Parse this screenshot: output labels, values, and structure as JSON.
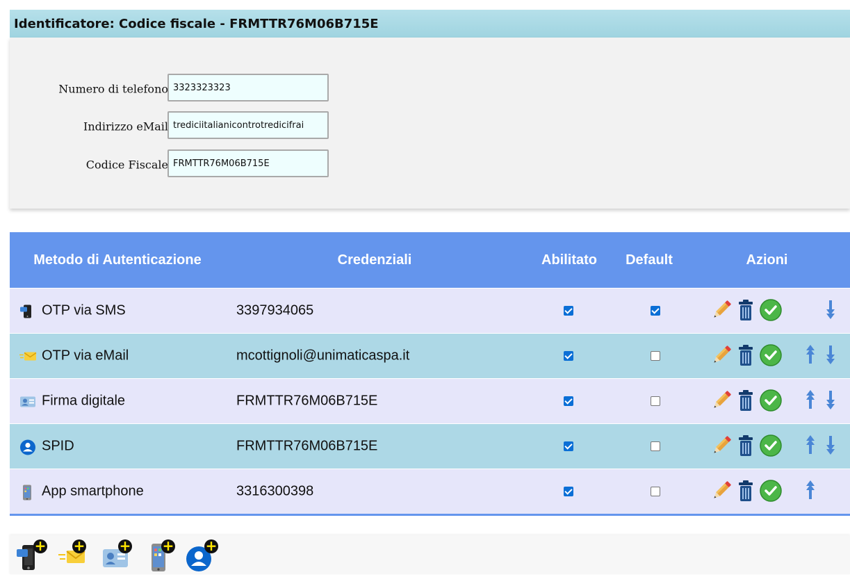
{
  "header": {
    "title": "Identificatore: Codice fiscale - FRMTTR76M06B715E"
  },
  "form": {
    "phone_label": "Numero di telefono",
    "phone_value": "3323323323",
    "email_label": "Indirizzo eMail",
    "email_value": "trediciitalianicontrotredicifrai",
    "cf_label": "Codice Fiscale",
    "cf_value": "FRMTTR76M06B715E"
  },
  "table": {
    "headers": {
      "method": "Metodo di Autenticazione",
      "credentials": "Credenziali",
      "enabled": "Abilitato",
      "default": "Default",
      "actions": "Azioni"
    },
    "rows": [
      {
        "method": "OTP via SMS",
        "icon": "sms-phone-icon",
        "credentials": "3397934065",
        "enabled": true,
        "default": true,
        "can_move_up": false,
        "can_move_down": true
      },
      {
        "method": "OTP via eMail",
        "icon": "email-envelope-icon",
        "credentials": "mcottignoli@unimaticaspa.it",
        "enabled": true,
        "default": false,
        "can_move_up": true,
        "can_move_down": true
      },
      {
        "method": "Firma digitale",
        "icon": "id-card-icon",
        "credentials": "FRMTTR76M06B715E",
        "enabled": true,
        "default": false,
        "can_move_up": true,
        "can_move_down": true
      },
      {
        "method": "SPID",
        "icon": "spid-user-icon",
        "credentials": "FRMTTR76M06B715E",
        "enabled": true,
        "default": false,
        "can_move_up": true,
        "can_move_down": true
      },
      {
        "method": "App smartphone",
        "icon": "smartphone-icon",
        "credentials": "3316300398",
        "enabled": true,
        "default": false,
        "can_move_up": true,
        "can_move_down": false
      }
    ]
  },
  "footer": {
    "add_buttons": [
      "add-sms-icon",
      "add-email-icon",
      "add-signature-icon",
      "add-smartphone-icon",
      "add-spid-icon"
    ]
  },
  "colors": {
    "header_bar": "#a8d8e3",
    "table_header": "#6495ed",
    "row_light": "#e6e6fa",
    "row_dark": "#add8e6",
    "checkbox_checked": "#0b6fd6"
  }
}
